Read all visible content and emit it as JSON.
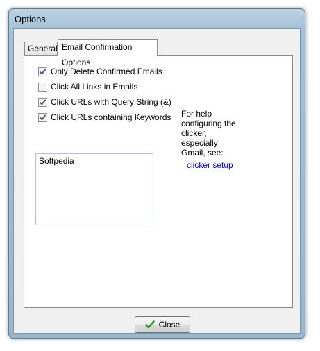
{
  "window": {
    "title": "Options"
  },
  "tabs": [
    {
      "label": "General"
    },
    {
      "label": "Email Confirmation Options"
    }
  ],
  "options": [
    {
      "label": "Only Delete Confirmed Emails",
      "checked": true
    },
    {
      "label": "Click All Links in Emails",
      "checked": false
    },
    {
      "label": "Click URLs with Query String (&)",
      "checked": true
    },
    {
      "label": "Click URLs containing Keywords",
      "checked": true
    }
  ],
  "keywords_value": "Softpedia",
  "help_text": "For help configuring the clicker, especially Gmail, see:",
  "setup_link": "clicker setup",
  "buttons": {
    "close_label": "Close"
  },
  "icons": {
    "close_button_icon": "green-check-icon"
  },
  "colors": {
    "check_icon": "#2f9a2f",
    "link": "#0000cc"
  }
}
